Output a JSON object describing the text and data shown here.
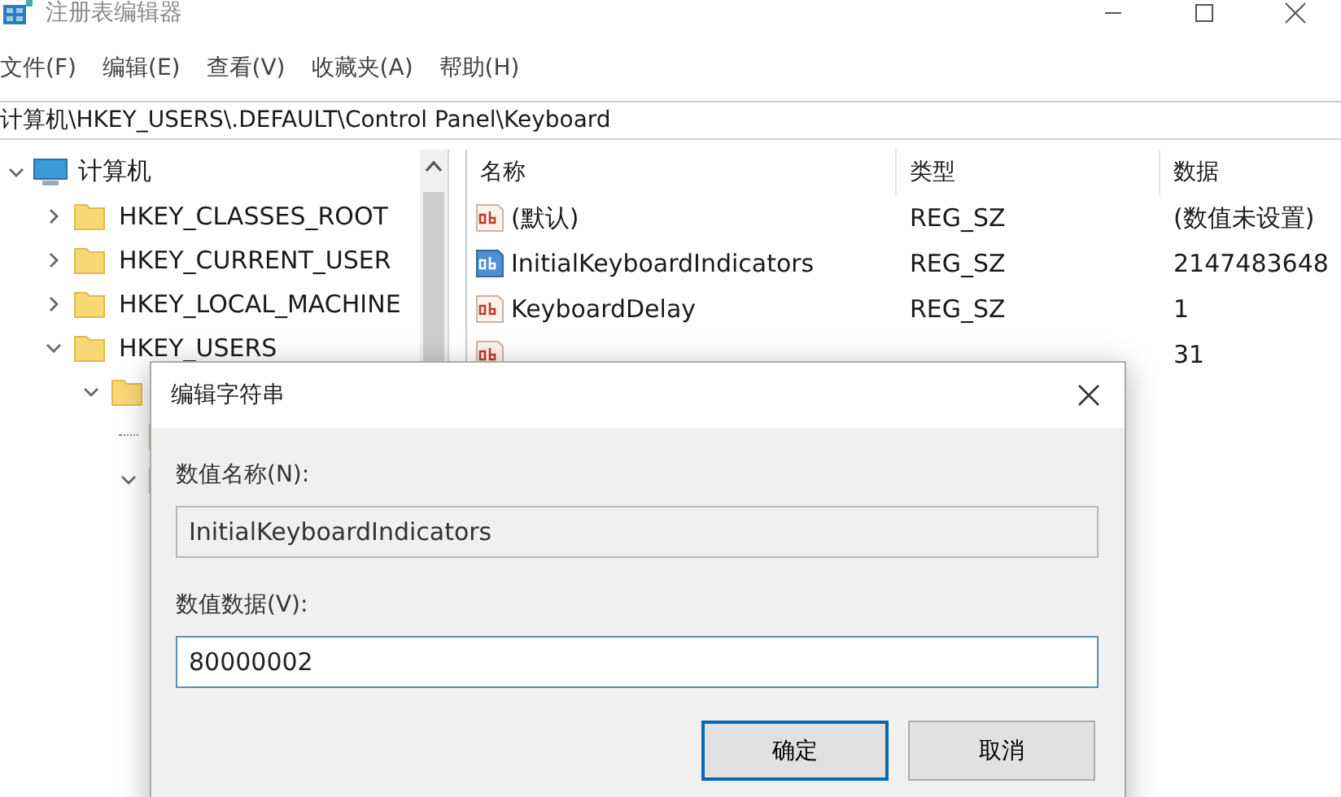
{
  "window": {
    "title": "注册表编辑器"
  },
  "menu": [
    "文件(F)",
    "编辑(E)",
    "查看(V)",
    "收藏夹(A)",
    "帮助(H)"
  ],
  "address": "计算机\\HKEY_USERS\\.DEFAULT\\Control Panel\\Keyboard",
  "tree": [
    {
      "label": "计算机",
      "kind": "computer",
      "expanded": true,
      "children": [
        {
          "label": "HKEY_CLASSES_ROOT",
          "kind": "folder",
          "expanded": false
        },
        {
          "label": "HKEY_CURRENT_USER",
          "kind": "folder",
          "expanded": false
        },
        {
          "label": "HKEY_LOCAL_MACHINE",
          "kind": "folder",
          "expanded": false
        },
        {
          "label": "HKEY_USERS",
          "kind": "folder",
          "expanded": true,
          "children": [
            {
              "kind": "folder",
              "expanded": true,
              "children": [
                {
                  "kind": "folder"
                },
                {
                  "kind": "folder",
                  "expanded": true
                }
              ]
            }
          ]
        }
      ]
    }
  ],
  "table": {
    "columns": [
      "名称",
      "类型",
      "数据"
    ],
    "rows": [
      {
        "name": "(默认)",
        "type": "REG_SZ",
        "data": "(数值未设置)",
        "selected": false
      },
      {
        "name": "InitialKeyboardIndicators",
        "type": "REG_SZ",
        "data": "2147483648",
        "selected": true
      },
      {
        "name": "KeyboardDelay",
        "type": "REG_SZ",
        "data": "1",
        "selected": false
      },
      {
        "data": "31",
        "selected": false
      }
    ]
  },
  "dialog": {
    "title": "编辑字符串",
    "name_label": "数值名称(N):",
    "name_value": "InitialKeyboardIndicators",
    "data_label": "数值数据(V):",
    "data_value": "80000002",
    "buttons": [
      {
        "label": "确定",
        "default": true
      },
      {
        "label": "取消",
        "default": false
      }
    ]
  }
}
